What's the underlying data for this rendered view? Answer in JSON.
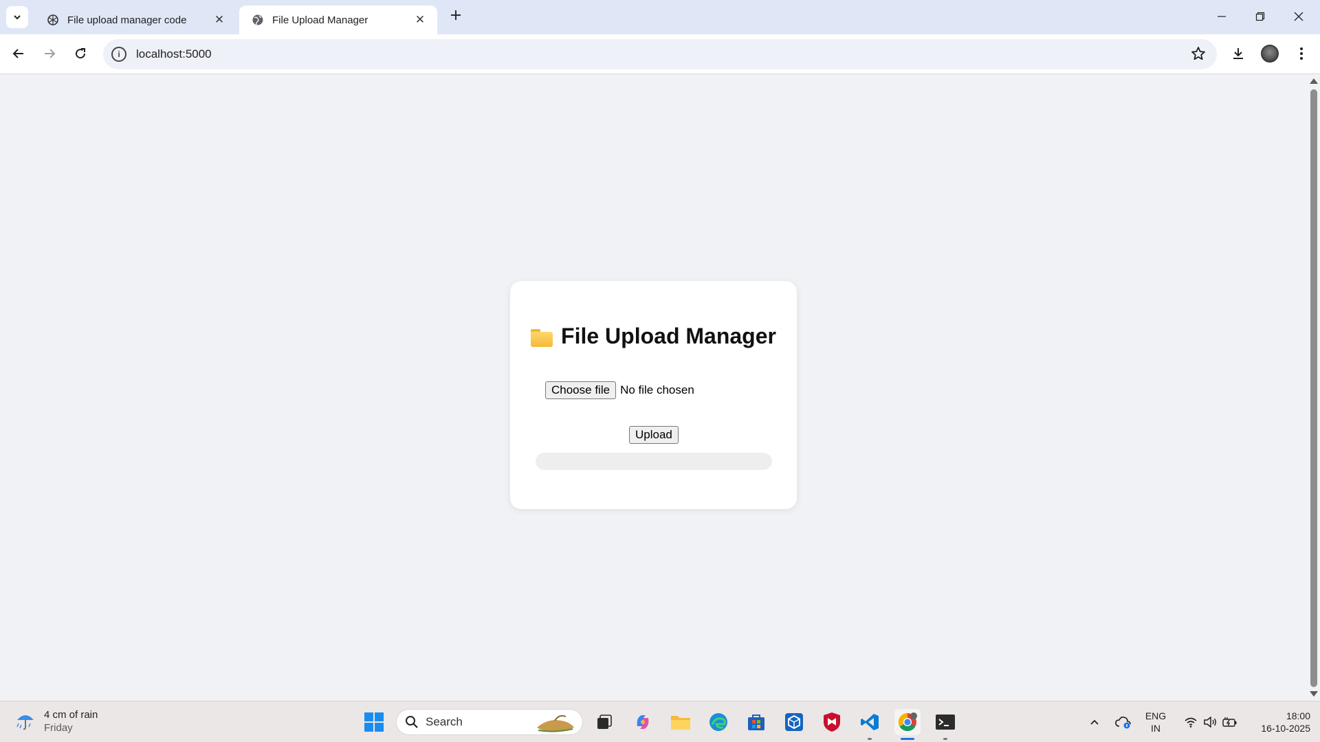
{
  "browser": {
    "tabs": [
      {
        "title": "File upload manager code",
        "active": false,
        "favicon": "openai-icon"
      },
      {
        "title": "File Upload Manager",
        "active": true,
        "favicon": "globe-icon"
      }
    ],
    "url": "localhost:5000"
  },
  "page": {
    "title": "File Upload Manager",
    "title_icon": "folder-icon",
    "choose_file_label": "Choose file",
    "no_file_text": "No file chosen",
    "upload_label": "Upload",
    "progress_fraction": 0
  },
  "taskbar": {
    "weather": {
      "main": "4 cm of rain",
      "sub": "Friday"
    },
    "search_placeholder": "Search",
    "language": {
      "line1": "ENG",
      "line2": "IN"
    },
    "clock": {
      "time": "18:00",
      "date": "16-10-2025"
    }
  },
  "colors": {
    "page_bg": "#f0f2f5",
    "card_bg": "#ffffff",
    "tabstrip_bg": "#dfe7f7",
    "taskbar_bg": "#ebe7e6",
    "progress_fill": "#4caf50"
  }
}
